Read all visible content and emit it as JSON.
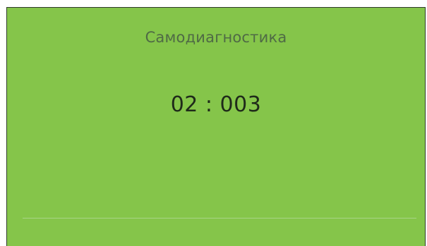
{
  "screen": {
    "title": "Самодиагностика",
    "timer": "02 : 003"
  }
}
